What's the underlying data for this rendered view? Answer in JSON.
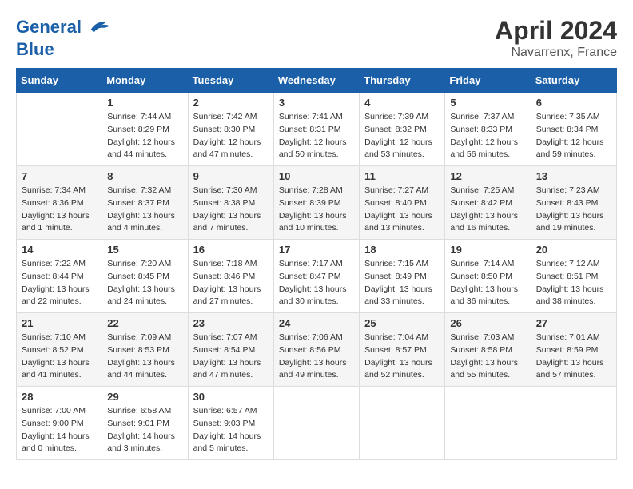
{
  "header": {
    "logo_line1": "General",
    "logo_line2": "Blue",
    "month_year": "April 2024",
    "location": "Navarrenx, France"
  },
  "weekdays": [
    "Sunday",
    "Monday",
    "Tuesday",
    "Wednesday",
    "Thursday",
    "Friday",
    "Saturday"
  ],
  "weeks": [
    [
      {
        "day": "",
        "sunrise": "",
        "sunset": "",
        "daylight": ""
      },
      {
        "day": "1",
        "sunrise": "7:44 AM",
        "sunset": "8:29 PM",
        "daylight": "12 hours and 44 minutes."
      },
      {
        "day": "2",
        "sunrise": "7:42 AM",
        "sunset": "8:30 PM",
        "daylight": "12 hours and 47 minutes."
      },
      {
        "day": "3",
        "sunrise": "7:41 AM",
        "sunset": "8:31 PM",
        "daylight": "12 hours and 50 minutes."
      },
      {
        "day": "4",
        "sunrise": "7:39 AM",
        "sunset": "8:32 PM",
        "daylight": "12 hours and 53 minutes."
      },
      {
        "day": "5",
        "sunrise": "7:37 AM",
        "sunset": "8:33 PM",
        "daylight": "12 hours and 56 minutes."
      },
      {
        "day": "6",
        "sunrise": "7:35 AM",
        "sunset": "8:34 PM",
        "daylight": "12 hours and 59 minutes."
      }
    ],
    [
      {
        "day": "7",
        "sunrise": "7:34 AM",
        "sunset": "8:36 PM",
        "daylight": "13 hours and 1 minute."
      },
      {
        "day": "8",
        "sunrise": "7:32 AM",
        "sunset": "8:37 PM",
        "daylight": "13 hours and 4 minutes."
      },
      {
        "day": "9",
        "sunrise": "7:30 AM",
        "sunset": "8:38 PM",
        "daylight": "13 hours and 7 minutes."
      },
      {
        "day": "10",
        "sunrise": "7:28 AM",
        "sunset": "8:39 PM",
        "daylight": "13 hours and 10 minutes."
      },
      {
        "day": "11",
        "sunrise": "7:27 AM",
        "sunset": "8:40 PM",
        "daylight": "13 hours and 13 minutes."
      },
      {
        "day": "12",
        "sunrise": "7:25 AM",
        "sunset": "8:42 PM",
        "daylight": "13 hours and 16 minutes."
      },
      {
        "day": "13",
        "sunrise": "7:23 AM",
        "sunset": "8:43 PM",
        "daylight": "13 hours and 19 minutes."
      }
    ],
    [
      {
        "day": "14",
        "sunrise": "7:22 AM",
        "sunset": "8:44 PM",
        "daylight": "13 hours and 22 minutes."
      },
      {
        "day": "15",
        "sunrise": "7:20 AM",
        "sunset": "8:45 PM",
        "daylight": "13 hours and 24 minutes."
      },
      {
        "day": "16",
        "sunrise": "7:18 AM",
        "sunset": "8:46 PM",
        "daylight": "13 hours and 27 minutes."
      },
      {
        "day": "17",
        "sunrise": "7:17 AM",
        "sunset": "8:47 PM",
        "daylight": "13 hours and 30 minutes."
      },
      {
        "day": "18",
        "sunrise": "7:15 AM",
        "sunset": "8:49 PM",
        "daylight": "13 hours and 33 minutes."
      },
      {
        "day": "19",
        "sunrise": "7:14 AM",
        "sunset": "8:50 PM",
        "daylight": "13 hours and 36 minutes."
      },
      {
        "day": "20",
        "sunrise": "7:12 AM",
        "sunset": "8:51 PM",
        "daylight": "13 hours and 38 minutes."
      }
    ],
    [
      {
        "day": "21",
        "sunrise": "7:10 AM",
        "sunset": "8:52 PM",
        "daylight": "13 hours and 41 minutes."
      },
      {
        "day": "22",
        "sunrise": "7:09 AM",
        "sunset": "8:53 PM",
        "daylight": "13 hours and 44 minutes."
      },
      {
        "day": "23",
        "sunrise": "7:07 AM",
        "sunset": "8:54 PM",
        "daylight": "13 hours and 47 minutes."
      },
      {
        "day": "24",
        "sunrise": "7:06 AM",
        "sunset": "8:56 PM",
        "daylight": "13 hours and 49 minutes."
      },
      {
        "day": "25",
        "sunrise": "7:04 AM",
        "sunset": "8:57 PM",
        "daylight": "13 hours and 52 minutes."
      },
      {
        "day": "26",
        "sunrise": "7:03 AM",
        "sunset": "8:58 PM",
        "daylight": "13 hours and 55 minutes."
      },
      {
        "day": "27",
        "sunrise": "7:01 AM",
        "sunset": "8:59 PM",
        "daylight": "13 hours and 57 minutes."
      }
    ],
    [
      {
        "day": "28",
        "sunrise": "7:00 AM",
        "sunset": "9:00 PM",
        "daylight": "14 hours and 0 minutes."
      },
      {
        "day": "29",
        "sunrise": "6:58 AM",
        "sunset": "9:01 PM",
        "daylight": "14 hours and 3 minutes."
      },
      {
        "day": "30",
        "sunrise": "6:57 AM",
        "sunset": "9:03 PM",
        "daylight": "14 hours and 5 minutes."
      },
      {
        "day": "",
        "sunrise": "",
        "sunset": "",
        "daylight": ""
      },
      {
        "day": "",
        "sunrise": "",
        "sunset": "",
        "daylight": ""
      },
      {
        "day": "",
        "sunrise": "",
        "sunset": "",
        "daylight": ""
      },
      {
        "day": "",
        "sunrise": "",
        "sunset": "",
        "daylight": ""
      }
    ]
  ],
  "labels": {
    "sunrise": "Sunrise:",
    "sunset": "Sunset:",
    "daylight": "Daylight:"
  }
}
